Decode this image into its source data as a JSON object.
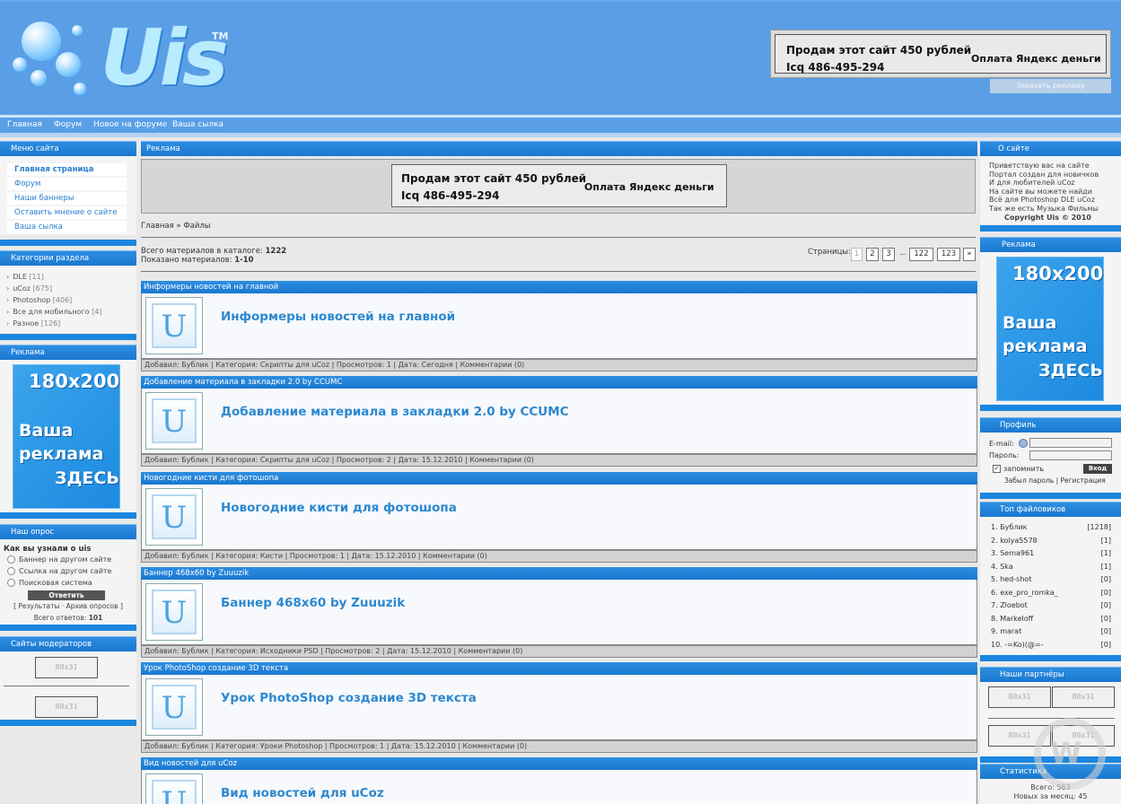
{
  "header": {
    "logo_text": "Uis",
    "logo_tm": "TM",
    "ad_line1": "Продам этот сайт 450 рублей",
    "ad_line2": "Icq 486-495-294",
    "ad_right": "Оплата Яндекс деньги",
    "order_ad": "Заказать рекламу"
  },
  "nav": [
    "Главная",
    "Форум",
    "Новое на форуме",
    "Ваша сылка"
  ],
  "left": {
    "menu_title": "Меню сайта",
    "menu": [
      "Главная страница",
      "Форум",
      "Наши баннеры",
      "Оставить мнение о сайте",
      "Ваша сылка"
    ],
    "cats_title": "Категории раздела",
    "cats": [
      {
        "name": "DLE",
        "count": "[11]"
      },
      {
        "name": "uCoz",
        "count": "[675]"
      },
      {
        "name": "Photoshop",
        "count": "[406]"
      },
      {
        "name": "Все для мобильного",
        "count": "[4]"
      },
      {
        "name": "Разное",
        "count": "[126]"
      }
    ],
    "ad_title": "Реклама",
    "banner_size": "180x200",
    "banner_l1": "Ваша",
    "banner_l2": "реклама",
    "banner_l3": "ЗДЕСЬ",
    "poll_title": "Наш опрос",
    "poll_q": "Как вы узнали о uis",
    "poll_opts": [
      "Баннер на другом сайте",
      "Ссылка на другом сайте",
      "Поисковая система"
    ],
    "poll_btn": "Ответить",
    "poll_links": "[ Результаты · Архив опросов ]",
    "poll_total_label": "Всего ответов:",
    "poll_total": "101",
    "mods_title": "Сайты модераторов",
    "b88": "88x31"
  },
  "center": {
    "ad_title": "Реклама",
    "crumb": "Главная » Файлы",
    "total_label": "Всего материалов в каталоге:",
    "total": "1222",
    "shown_label": "Показано материалов:",
    "shown": "1-10",
    "pages_label": "Страницы:",
    "pages": [
      "1",
      "2",
      "3",
      "...",
      "122",
      "123",
      "»"
    ],
    "entries": [
      {
        "title": "Информеры новостей на главной",
        "meta": "Добавил: Бублик | Категория: Скрипты для uCoz | Просмотров: 1 | Дата: Сегодня | Комментарии (0)"
      },
      {
        "title": "Добавление материала в закладки 2.0 by CCUMC",
        "meta": "Добавил: Бублик | Категория: Скрипты для uCoz | Просмотров: 2 | Дата: 15.12.2010 | Комментарии (0)"
      },
      {
        "title": "Новогодние кисти для фотошопа",
        "meta": "Добавил: Бублик | Категория: Кисти | Просмотров: 1 | Дата: 15.12.2010 | Комментарии (0)"
      },
      {
        "title": "Баннер 468х60 by Zuuuzik",
        "meta": "Добавил: Бублик | Категория: Исходники PSD | Просмотров: 2 | Дата: 15.12.2010 | Комментарии (0)"
      },
      {
        "title": "Урок PhotoShop создание 3D текста",
        "meta": "Добавил: Бублик | Категория: Уроки Photoshop | Просмотров: 1 | Дата: 15.12.2010 | Комментарии (0)"
      },
      {
        "title": "Вид новостей для uCoz",
        "meta": ""
      }
    ],
    "thumb_letter": "U"
  },
  "right": {
    "about_title": "О сайте",
    "about": [
      "Приветствую вас на сайте",
      "Портал создан для новичков",
      "И для любителей uCoz",
      "На сайте вы можете найди",
      "Всё для Photoshop DLE uCoz",
      "Так же есть Музыка Фильмы"
    ],
    "copyright": "Copyright Uis © 2010",
    "ad_title": "Реклама",
    "profile_title": "Профиль",
    "email_label": "E-mail:",
    "pass_label": "Пароль:",
    "remember": "запомнить",
    "login_btn": "Вход",
    "forgot": "Забыл пароль | Регистрация",
    "top_title": "Топ файловиков",
    "top": [
      {
        "n": "1.",
        "name": "Бублик",
        "v": "[1218]"
      },
      {
        "n": "2.",
        "name": "kolya5578",
        "v": "[1]"
      },
      {
        "n": "3.",
        "name": "Sema961",
        "v": "[1]"
      },
      {
        "n": "4.",
        "name": "Ska",
        "v": "[1]"
      },
      {
        "n": "5.",
        "name": "hed-shot",
        "v": "[0]"
      },
      {
        "n": "6.",
        "name": "exe_pro_romka_",
        "v": "[0]"
      },
      {
        "n": "7.",
        "name": "Zloebot",
        "v": "[0]"
      },
      {
        "n": "8.",
        "name": "Markeloff",
        "v": "[0]"
      },
      {
        "n": "9.",
        "name": "marat",
        "v": "[0]"
      },
      {
        "n": "10.",
        "name": "-=Ko)(@=-",
        "v": "[0]"
      }
    ],
    "partners_title": "Наши партнёры",
    "stats_title": "Статистика",
    "stat_total_label": "Всего:",
    "stat_total": "563",
    "stat_month_label": "Новых за месяц:",
    "stat_month": "45"
  },
  "colors": {
    "header": "#5a9fe6",
    "title_bar": "#1a78cf",
    "link": "#2d88cf"
  }
}
